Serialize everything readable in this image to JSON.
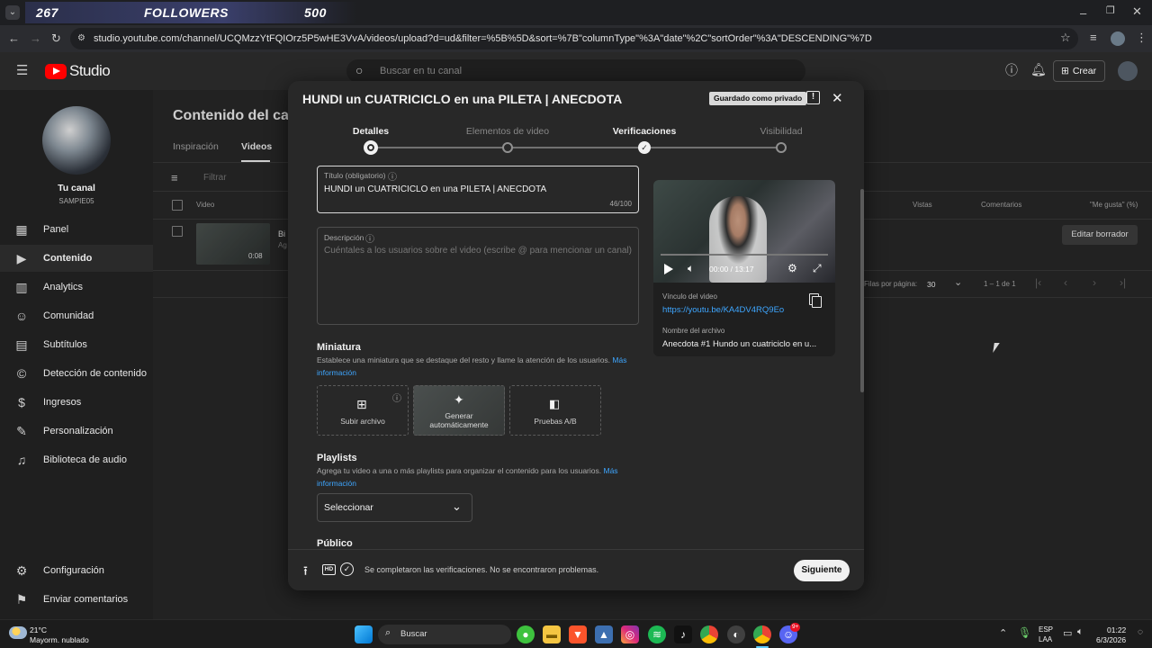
{
  "browser": {
    "counter": {
      "followers_count": "267",
      "followers_label": "FOLLOWERS",
      "goal": "500"
    },
    "url": "studio.youtube.com/channel/UCQMzzYtFQIOrz5P5wHE3VvA/videos/upload?d=ud&filter=%5B%5D&sort=%7B\"columnType\"%3A\"date\"%2C\"sortOrder\"%3A\"DESCENDING\"%7D"
  },
  "studio": {
    "logo": "Studio",
    "search_placeholder": "Buscar en tu canal",
    "create_label": "Crear",
    "channel_label": "Tu canal",
    "channel_name": "SAMPIE05",
    "nav": [
      {
        "label": "Panel",
        "icon": "grid-icon"
      },
      {
        "label": "Contenido",
        "icon": "content-icon"
      },
      {
        "label": "Analytics",
        "icon": "analytics-icon"
      },
      {
        "label": "Comunidad",
        "icon": "community-icon"
      },
      {
        "label": "Subtítulos",
        "icon": "subtitles-icon"
      },
      {
        "label": "Detección de contenido",
        "icon": "copyright-icon"
      },
      {
        "label": "Ingresos",
        "icon": "dollar-icon"
      },
      {
        "label": "Personalización",
        "icon": "wand-icon"
      },
      {
        "label": "Biblioteca de audio",
        "icon": "audio-library-icon"
      }
    ],
    "settings_label": "Configuración",
    "feedback_label": "Enviar comentarios",
    "page_title": "Contenido del canal",
    "tabs": [
      "Inspiración",
      "Videos"
    ],
    "filter_placeholder": "Filtrar",
    "columns": {
      "video": "Video",
      "views": "Vistas",
      "comments": "Comentarios",
      "likes": "\"Me gusta\" (%)"
    },
    "row": {
      "title_stub": "Bi",
      "subtitle_stub": "Ag",
      "duration": "0:08",
      "edit_draft": "Editar borrador"
    },
    "pagination": {
      "rows_label": "Filas por página:",
      "rows_value": "30",
      "range": "1 – 1 de 1"
    }
  },
  "modal": {
    "title": "HUNDI un CUATRICICLO en una PILETA | ANECDOTA",
    "saved_badge": "Guardado como privado",
    "steps": [
      "Detalles",
      "Elementos de video",
      "Verificaciones",
      "Visibilidad"
    ],
    "title_field": {
      "label": "Título (obligatorio)",
      "value": "HUNDI un CUATRICICLO en una PILETA | ANECDOTA",
      "counter": "46/100"
    },
    "description_field": {
      "label": "Descripción",
      "placeholder": "Cuéntales a los usuarios sobre el video (escribe @ para mencionar un canal)"
    },
    "thumbnail": {
      "title": "Miniatura",
      "desc": "Establece una miniatura que se destaque del resto y llame la atención de los usuarios.",
      "more": "Más información",
      "upload": "Subir archivo",
      "auto_line1": "Generar",
      "auto_line2": "automáticamente",
      "ab": "Pruebas A/B"
    },
    "playlists": {
      "title": "Playlists",
      "desc": "Agrega tu video a una o más playlists para organizar el contenido para los usuarios.",
      "more": "Más información",
      "select": "Seleccionar"
    },
    "audience_title": "Público",
    "preview": {
      "time": "00:00 / 13:17",
      "link_label": "Vínculo del video",
      "link": "https://youtu.be/KA4DV4RQ9Eo",
      "file_label": "Nombre del archivo",
      "file": "Anecdota #1 Hundo un cuatriciclo en u..."
    },
    "footer_status": "Se completaron las verificaciones. No se encontraron problemas.",
    "hd_badge": "HD",
    "next": "Siguiente"
  },
  "taskbar": {
    "weather_temp": "21°C",
    "weather_desc": "Mayorm. nublado",
    "search": "Buscar",
    "lang_line1": "ESP",
    "lang_line2": "LAA",
    "time": "01:22",
    "date": "6/3/2026",
    "discord_badge": "9+"
  }
}
